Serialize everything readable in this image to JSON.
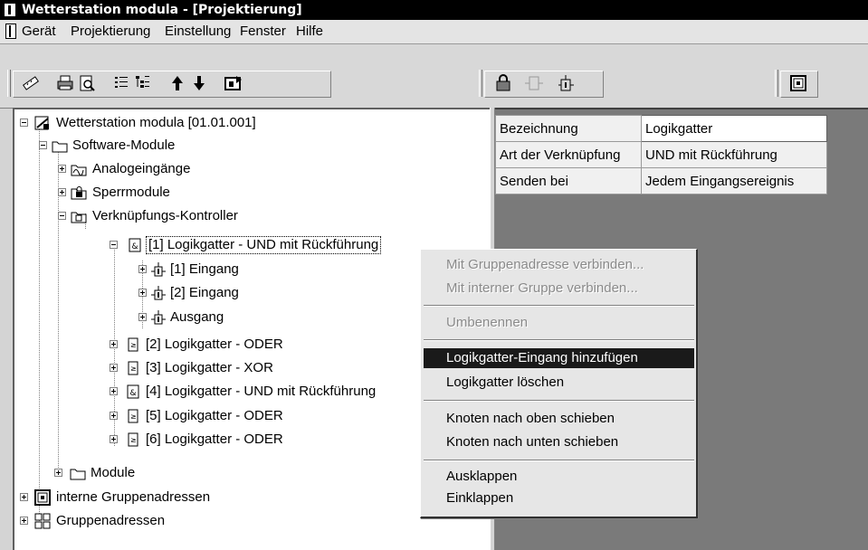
{
  "window": {
    "title": "Wetterstation modula  - [Projektierung]"
  },
  "menubar": {
    "items": [
      "Gerät",
      "Projektierung",
      "Einstellung",
      "Fenster",
      "Hilfe"
    ]
  },
  "toolbar": {
    "buttons": [
      "ruler-icon",
      "print-icon",
      "print-preview-icon",
      "list-icon",
      "tree-icon",
      "arrow-up-icon",
      "arrow-down-icon",
      "export-icon",
      "lock-icon",
      "gate-icon",
      "input-icon",
      "group-icon"
    ]
  },
  "tree": {
    "root": "Wetterstation modula [01.01.001]",
    "software_modules": "Software-Module",
    "analog": "Analogeingänge",
    "sperr": "Sperrmodule",
    "verkn": "Verknüpfungs-Kontroller",
    "gate1": "[1] Logikgatter - UND mit Rückführung",
    "in1": "[1] Eingang",
    "in2": "[2] Eingang",
    "out": "Ausgang",
    "gate2": "[2] Logikgatter - ODER",
    "gate3": "[3] Logikgatter - XOR",
    "gate4": "[4] Logikgatter - UND mit Rückführung",
    "gate5": "[5] Logikgatter - ODER",
    "gate6": "[6] Logikgatter - ODER",
    "module": "Module",
    "internal_groups": "interne Gruppenadressen",
    "groups": "Gruppenadressen"
  },
  "properties": [
    {
      "key": "Bezeichnung",
      "value": "Logikgatter"
    },
    {
      "key": "Art der Verknüpfung",
      "value": "UND mit Rückführung"
    },
    {
      "key": "Senden bei",
      "value": "Jedem Eingangsereignis"
    }
  ],
  "context_menu": {
    "connect_group": "Mit Gruppenadresse verbinden...",
    "connect_internal": "Mit interner Gruppe verbinden...",
    "rename": "Umbenennen",
    "add_input": "Logikgatter-Eingang hinzufügen",
    "delete_gate": "Logikgatter löschen",
    "move_up": "Knoten nach oben schieben",
    "move_down": "Knoten nach unten schieben",
    "expand": "Ausklappen",
    "collapse": "Einklappen"
  }
}
